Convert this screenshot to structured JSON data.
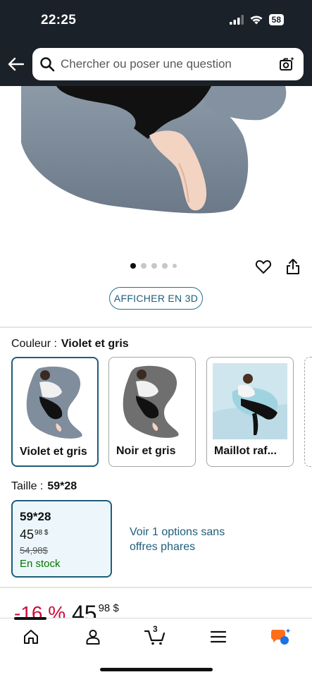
{
  "status_bar": {
    "time": "22:25",
    "battery": "58"
  },
  "search": {
    "placeholder": "Chercher ou poser une question"
  },
  "gallery": {
    "dot_count": 5,
    "active_index": 0,
    "view_3d_label": "AFFICHER EN 3D"
  },
  "color": {
    "label": "Couleur :",
    "selected": "Violet et gris",
    "options": [
      {
        "label": "Violet et gris",
        "selected": true
      },
      {
        "label": "Noir et gris",
        "selected": false
      },
      {
        "label": "Maillot raf...",
        "selected": false
      }
    ]
  },
  "size": {
    "label": "Taille :",
    "selected": "59*28",
    "card": {
      "name": "59*28",
      "price_whole": "45",
      "price_fraction": "98 $",
      "old_price": "54,98$",
      "stock": "En stock"
    },
    "more_options": "Voir 1 options sans offres phares"
  },
  "price": {
    "discount": "-16 %",
    "whole": "45",
    "fraction": "98 $"
  },
  "bottom_nav": {
    "cart_count": "3"
  },
  "colors": {
    "accent": "#1d5d7a",
    "header_bg": "#1b2128",
    "discount": "#cc0c39",
    "stock": "#007600"
  }
}
